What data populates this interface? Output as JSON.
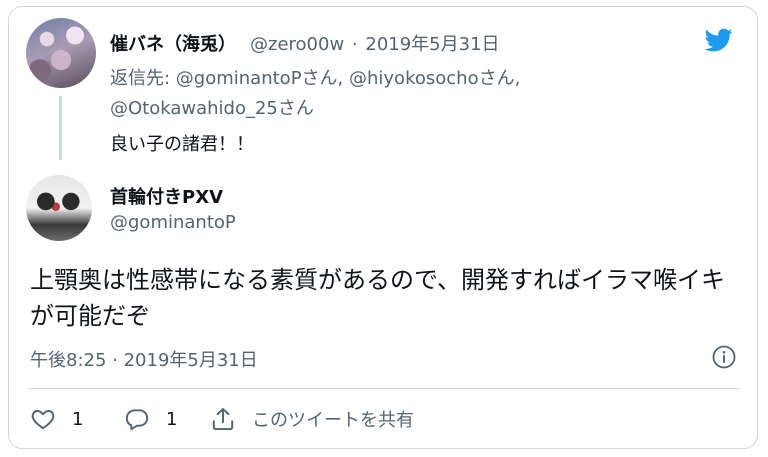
{
  "parent_tweet": {
    "display_name": "催バネ（海兎）",
    "handle": "@zero00w",
    "separator": "·",
    "date": "2019年5月31日",
    "reply_prefix": "返信先: ",
    "reply_mentions": [
      {
        "handle": "@gominantoP",
        "suffix": "さん, "
      },
      {
        "handle": "@hiyokosocho",
        "suffix": "さん, "
      },
      {
        "handle": "@Otokawahido_25",
        "suffix": "さん"
      }
    ],
    "text": "良い子の諸君！！"
  },
  "main_tweet": {
    "display_name": "首輪付きPXV",
    "handle": "@gominantoP",
    "text": "上顎奥は性感帯になる素質があるので、開発すればイラマ喉イキが可能だぞ",
    "timestamp": "午後8:25 · 2019年5月31日"
  },
  "actions": {
    "like_count": "1",
    "reply_count": "1",
    "share_label": "このツイートを共有"
  },
  "colors": {
    "brand_blue": "#1d9bf0",
    "text_primary": "#0f1419",
    "text_secondary": "#536471",
    "border": "#cfd9de"
  },
  "icons": {
    "brand": "twitter-bird-icon",
    "info": "info-icon",
    "like": "heart-icon",
    "reply": "reply-bubble-icon",
    "share": "share-icon"
  }
}
